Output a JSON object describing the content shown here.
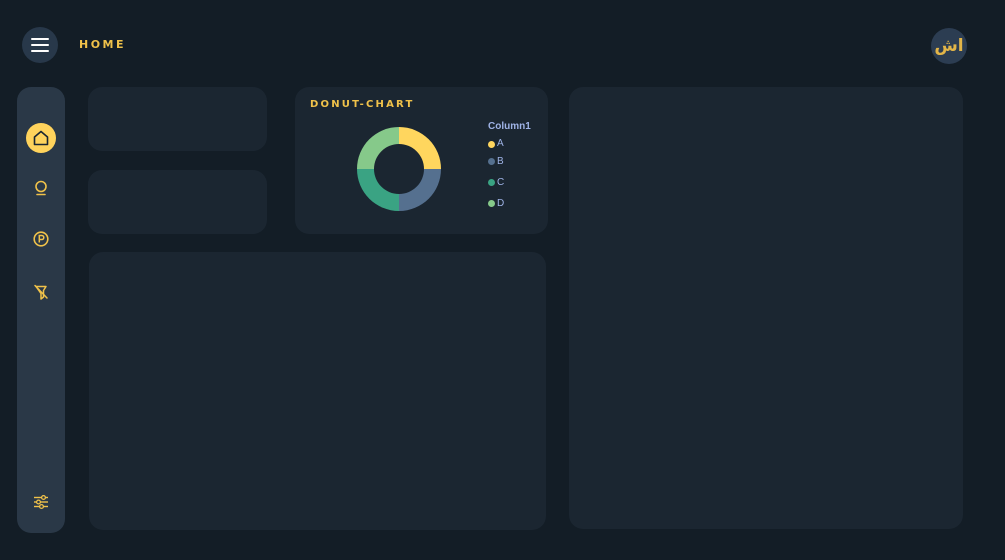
{
  "header": {
    "title": "HOME",
    "logo_text": "اش"
  },
  "sidebar": {
    "items": [
      {
        "icon": "home-icon",
        "active": true
      },
      {
        "icon": "lightbulb-icon",
        "active": false
      },
      {
        "icon": "parking-icon",
        "active": false
      },
      {
        "icon": "no-parking-icon",
        "active": false
      }
    ],
    "bottom_icon": "sliders-icon"
  },
  "colors": {
    "accent": "#ffd35c",
    "background": "#131d26",
    "panel": "#1b2631",
    "sidebar": "#2a3847"
  },
  "chart_data": {
    "type": "pie",
    "title": "DONUT-CHART",
    "legend_title": "Column1",
    "categories": [
      "A",
      "B",
      "C",
      "D"
    ],
    "values": [
      25,
      25,
      25,
      25
    ],
    "colors": [
      "#ffd65e",
      "#55708f",
      "#3aa383",
      "#86c98a"
    ]
  }
}
